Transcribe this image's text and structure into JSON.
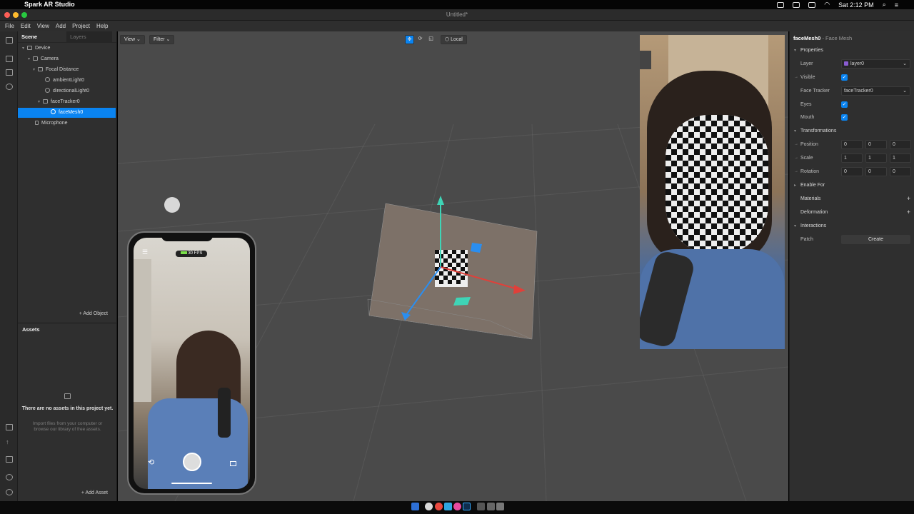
{
  "menubar": {
    "app_name": "Spark AR Studio",
    "clock": "Sat 2:12 PM"
  },
  "window": {
    "title": "Untitled*"
  },
  "app_menu": [
    "File",
    "Edit",
    "View",
    "Add",
    "Project",
    "Help"
  ],
  "scene_panel": {
    "tab_scene": "Scene",
    "tab_layers": "Layers",
    "tree": [
      {
        "label": "Device",
        "indent": 0,
        "icon": "device-icon"
      },
      {
        "label": "Camera",
        "indent": 1,
        "icon": "camera-icon"
      },
      {
        "label": "Focal Distance",
        "indent": 2,
        "icon": "focal-distance-icon"
      },
      {
        "label": "ambientLight0",
        "indent": 3,
        "icon": "light-icon"
      },
      {
        "label": "directionalLight0",
        "indent": 3,
        "icon": "light-icon"
      },
      {
        "label": "faceTracker0",
        "indent": 3,
        "icon": "face-tracker-icon"
      },
      {
        "label": "faceMesh0",
        "indent": 4,
        "icon": "face-mesh-icon",
        "selected": true
      },
      {
        "label": "Microphone",
        "indent": 1,
        "icon": "microphone-icon"
      }
    ],
    "add_object": "+ Add Object"
  },
  "assets_panel": {
    "title": "Assets",
    "empty_title": "There are no assets in this project yet.",
    "empty_desc": "Import files from your computer or browse our library of free assets.",
    "add_asset": "+ Add Asset"
  },
  "viewport": {
    "view_button": "View",
    "filter_button": "Filter",
    "local_button": "Local"
  },
  "phone": {
    "fps": "30 FPS"
  },
  "inspector": {
    "object_name": "faceMesh0",
    "object_type": "- Face Mesh",
    "properties_header": "Properties",
    "layer_label": "Layer",
    "layer_value": "layer0",
    "visible_label": "Visible",
    "face_tracker_label": "Face Tracker",
    "face_tracker_value": "faceTracker0",
    "eyes_label": "Eyes",
    "mouth_label": "Mouth",
    "transformations_header": "Transformations",
    "position_label": "Position",
    "position": [
      "0",
      "0",
      "0"
    ],
    "scale_label": "Scale",
    "scale": [
      "1",
      "1",
      "1"
    ],
    "rotation_label": "Rotation",
    "rotation": [
      "0",
      "0",
      "0"
    ],
    "enable_for_label": "Enable For",
    "materials_label": "Materials",
    "deformation_label": "Deformation",
    "interactions_header": "Interactions",
    "patch_label": "Patch",
    "create_button": "Create"
  },
  "colors": {
    "accent": "#0a84f1",
    "layer_swatch": "#8a5cd1"
  }
}
